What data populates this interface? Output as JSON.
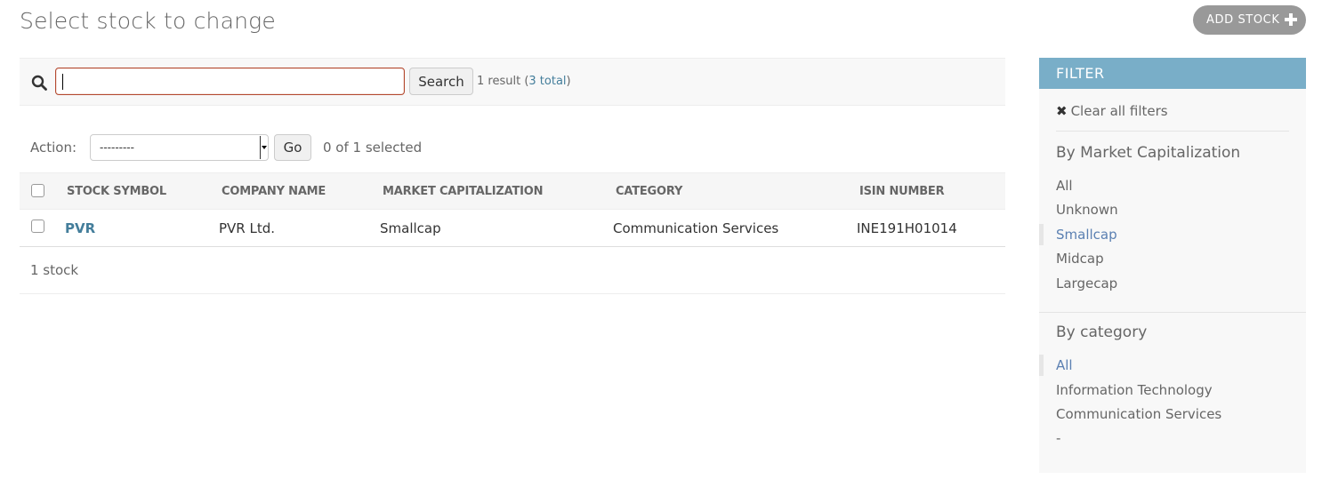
{
  "page": {
    "title": "Select stock to change",
    "add_button": "ADD STOCK"
  },
  "search": {
    "value": "",
    "button": "Search",
    "result_prefix": "1 result (",
    "result_total": "3 total",
    "result_suffix": ")"
  },
  "actions": {
    "label": "Action:",
    "selected_option": "---------",
    "go": "Go",
    "selected_count": "0 of 1 selected"
  },
  "table": {
    "headers": [
      "STOCK SYMBOL",
      "COMPANY NAME",
      "MARKET CAPITALIZATION",
      "CATEGORY",
      "ISIN NUMBER"
    ],
    "rows": [
      {
        "symbol": "PVR",
        "company": "PVR Ltd.",
        "market_cap": "Smallcap",
        "category": "Communication Services",
        "isin": "INE191H01014"
      }
    ],
    "footer": "1 stock"
  },
  "filter": {
    "title": "FILTER",
    "clear_icon": "✖",
    "clear": "Clear all filters",
    "groups": [
      {
        "title": "By Market Capitalization",
        "items": [
          "All",
          "Unknown",
          "Smallcap",
          "Midcap",
          "Largecap"
        ],
        "selected": "Smallcap"
      },
      {
        "title": "By category",
        "items": [
          "All",
          "Information Technology",
          "Communication Services",
          "-"
        ],
        "selected": "All"
      }
    ]
  },
  "colors": {
    "accent": "#79aec8",
    "link": "#447e9b",
    "selected_filter": "#5b80b2",
    "search_border": "#b44a30"
  }
}
